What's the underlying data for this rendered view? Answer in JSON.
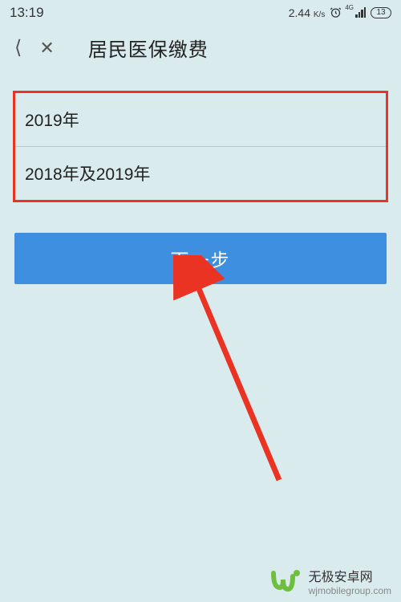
{
  "statusBar": {
    "time": "13:19",
    "speed": "2.44",
    "speedUnit": "K/s",
    "signal4g": "4G",
    "batteryLevel": "13"
  },
  "header": {
    "title": "居民医保缴费"
  },
  "options": {
    "item1": "2019年",
    "item2": "2018年及2019年"
  },
  "button": {
    "nextLabel": "下一步"
  },
  "watermark": {
    "name": "无极安卓网",
    "url": "wjmobilegroup.com"
  }
}
